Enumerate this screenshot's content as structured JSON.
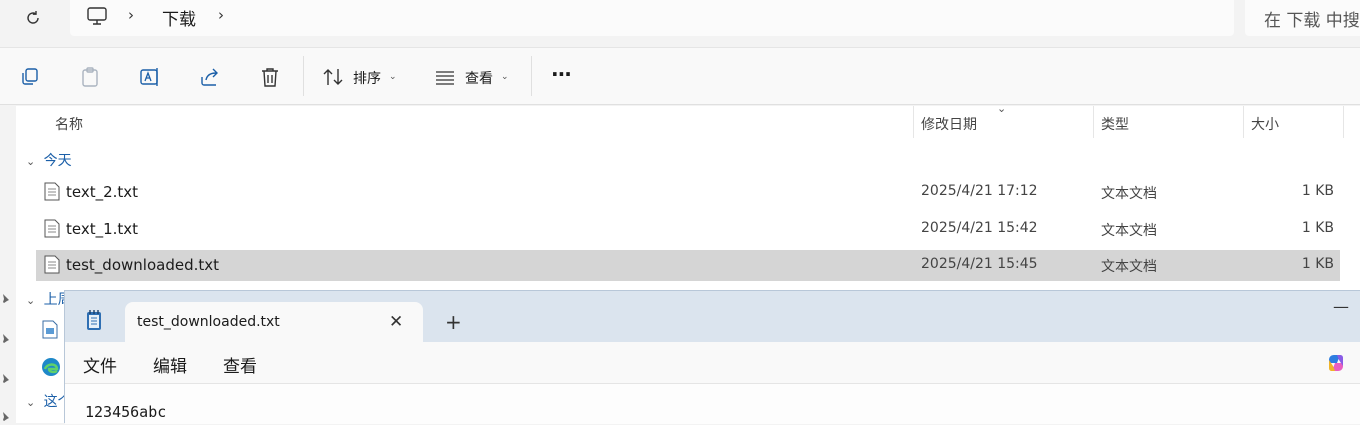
{
  "address": {
    "breadcrumb": "下载",
    "search_placeholder": "在 下载 中搜"
  },
  "toolbar": {
    "sort_label": "排序",
    "view_label": "查看",
    "more_label": "···"
  },
  "columns": {
    "name": "名称",
    "date": "修改日期",
    "type": "类型",
    "size": "大小"
  },
  "groups": {
    "today": "今天",
    "earlier_partial": "上周",
    "this_partial": "这个"
  },
  "files": [
    {
      "name": "text_2.txt",
      "date": "2025/4/21 17:12",
      "type": "文本文档",
      "size": "1 KB",
      "selected": false
    },
    {
      "name": "text_1.txt",
      "date": "2025/4/21 15:42",
      "type": "文本文档",
      "size": "1 KB",
      "selected": false
    },
    {
      "name": "test_downloaded.txt",
      "date": "2025/4/21 15:45",
      "type": "文本文档",
      "size": "1 KB",
      "selected": true
    }
  ],
  "notepad": {
    "tab_title": "test_downloaded.txt",
    "close_glyph": "✕",
    "plus_glyph": "+",
    "min_glyph": "—",
    "menu": {
      "file": "文件",
      "edit": "编辑",
      "view": "查看"
    },
    "content": "123456abc"
  },
  "icons": {
    "refresh": "refresh-icon",
    "pc": "computer-icon",
    "copy": "copy-icon",
    "paste": "paste-icon",
    "rename": "rename-icon",
    "share": "share-icon",
    "delete": "delete-icon",
    "sort": "sort-icon",
    "view": "view-icon",
    "file": "text-file-icon",
    "notepad": "notepad-app-icon",
    "copilot": "copilot-icon"
  },
  "colors": {
    "accent": "#1b5fa8",
    "selection": "#d5d5d5",
    "tabbar": "#dbe4ee"
  }
}
